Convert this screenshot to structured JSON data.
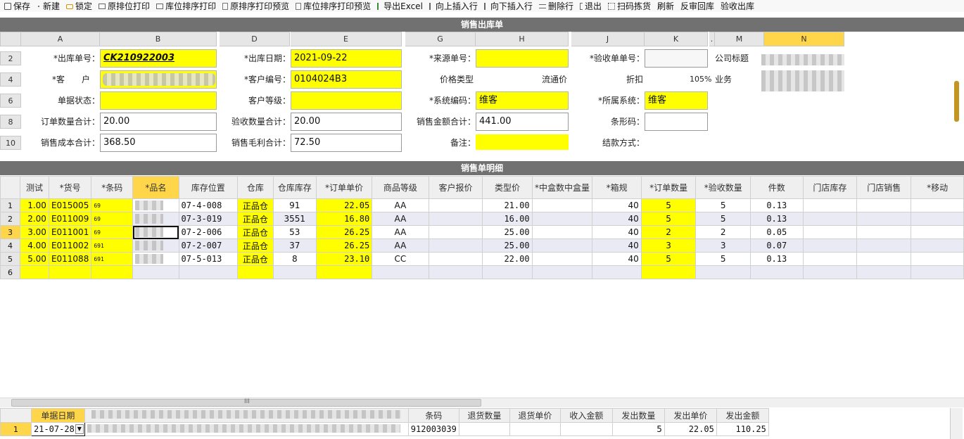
{
  "toolbar": [
    "保存",
    "新建",
    "锁定",
    "原排位打印",
    "库位排序打印",
    "原排序打印预览",
    "库位排序打印预览",
    "导出Excel",
    "向上插入行",
    "向下插入行",
    "删除行",
    "退出",
    "扫码拣货",
    "刷新",
    "反审回库",
    "验收出库"
  ],
  "toolbar_icons": [
    "save-icon",
    "new-icon",
    "lock-icon",
    "print-icon",
    "print-icon",
    "preview-icon",
    "preview-icon",
    "excel-icon",
    "insert-up-icon",
    "insert-down-icon",
    "delete-row-icon",
    "exit-icon",
    "scan-icon",
    "",
    "",
    ""
  ],
  "header_title": "销售出库单",
  "columns": [
    "A",
    "B",
    "D",
    "E",
    "G",
    "H",
    "J",
    "K",
    ".",
    "M",
    "N"
  ],
  "rows": [
    "2",
    "4",
    "6",
    "8",
    "10"
  ],
  "form": {
    "l_order_no": "*出库单号：",
    "v_order_no": "CK210922003",
    "l_date": "*出库日期：",
    "v_date": "2021-09-22",
    "l_source": "*来源单号：",
    "v_source": "",
    "l_check_no": "*验收单单号：",
    "v_check_no": "",
    "l_company": "公司标题",
    "l_customer": "*客　　户",
    "l_cust_code": "*客户编号：",
    "v_cust_code": "0104024B3",
    "l_price_type": "价格类型",
    "v_price_type": "流通价",
    "l_discount": "折扣",
    "v_discount": "105%",
    "l_business": "业务",
    "l_status": "单据状态：",
    "l_cust_level": "客户等级：",
    "l_sys_code": "*系统编码：",
    "v_sys_code": "维客",
    "l_sys": "*所属系统：",
    "v_sys": "维客",
    "l_qty_total": "订单数量合计：",
    "v_qty_total": "20.00",
    "l_check_total": "验收数量合计：",
    "v_check_total": "20.00",
    "l_amount_total": "销售金额合计：",
    "v_amount_total": "441.00",
    "l_barcode": "条形码：",
    "l_cost_total": "销售成本合计：",
    "v_cost_total": "368.50",
    "l_profit_total": "销售毛利合计：",
    "v_profit_total": "72.50",
    "l_remark": "备注：",
    "l_settle": "结款方式："
  },
  "detail_title": "销售单明细",
  "detail_headers": [
    "测试",
    "*货号",
    "*条码",
    "*品名",
    "库存位置",
    "仓库",
    "仓库库存",
    "*订单单价",
    "商品等级",
    "客户报价",
    "类型价",
    "*中盒数中盒量",
    "*箱规",
    "*订单数量",
    "*验收数量",
    "件数",
    "门店库存",
    "门店销售",
    "*移动"
  ],
  "detail_rows": [
    {
      "n": "1",
      "test": "1.00",
      "code": "E015005",
      "bar": "69",
      "loc": "07-4-008",
      "wh": "正品仓",
      "stock": "91",
      "price": "22.05",
      "grade": "AA",
      "tprice": "21.00",
      "box": "40",
      "qty": "5",
      "chk": "5",
      "pcs": "0.13"
    },
    {
      "n": "2",
      "test": "2.00",
      "code": "E011009",
      "bar": "69",
      "loc": "07-3-019",
      "wh": "正品仓",
      "stock": "3551",
      "price": "16.80",
      "grade": "AA",
      "tprice": "16.00",
      "box": "40",
      "qty": "5",
      "chk": "5",
      "pcs": "0.13"
    },
    {
      "n": "3",
      "test": "3.00",
      "code": "E011001",
      "bar": "69",
      "loc": "07-2-006",
      "wh": "正品仓",
      "stock": "53",
      "price": "26.25",
      "grade": "AA",
      "tprice": "25.00",
      "box": "40",
      "qty": "2",
      "chk": "2",
      "pcs": "0.05"
    },
    {
      "n": "4",
      "test": "4.00",
      "code": "E011002",
      "bar": "691",
      "loc": "07-2-007",
      "wh": "正品仓",
      "stock": "37",
      "price": "26.25",
      "grade": "AA",
      "tprice": "25.00",
      "box": "40",
      "qty": "3",
      "chk": "3",
      "pcs": "0.07"
    },
    {
      "n": "5",
      "test": "5.00",
      "code": "E011088",
      "bar": "691",
      "loc": "07-5-013",
      "wh": "正品仓",
      "stock": "8",
      "price": "23.10",
      "grade": "CC",
      "tprice": "22.00",
      "box": "40",
      "qty": "5",
      "chk": "5",
      "pcs": "0.13"
    },
    {
      "n": "6",
      "test": "",
      "code": "",
      "bar": "",
      "loc": "",
      "wh": "",
      "stock": "",
      "price": "",
      "grade": "",
      "tprice": "",
      "box": "",
      "qty": "",
      "chk": "",
      "pcs": ""
    }
  ],
  "scroll_marker": "III",
  "bottom_headers": [
    "单据日期",
    "条码",
    "退货数量",
    "退货单价",
    "收入金额",
    "发出数量",
    "发出单价",
    "发出金额"
  ],
  "bottom_row": {
    "n": "1",
    "date": "21-07-28",
    "bar": "912003039",
    "ret_qty": "",
    "ret_price": "",
    "income": "",
    "out_qty": "5",
    "out_price": "22.05",
    "out_amount": "110.25"
  }
}
